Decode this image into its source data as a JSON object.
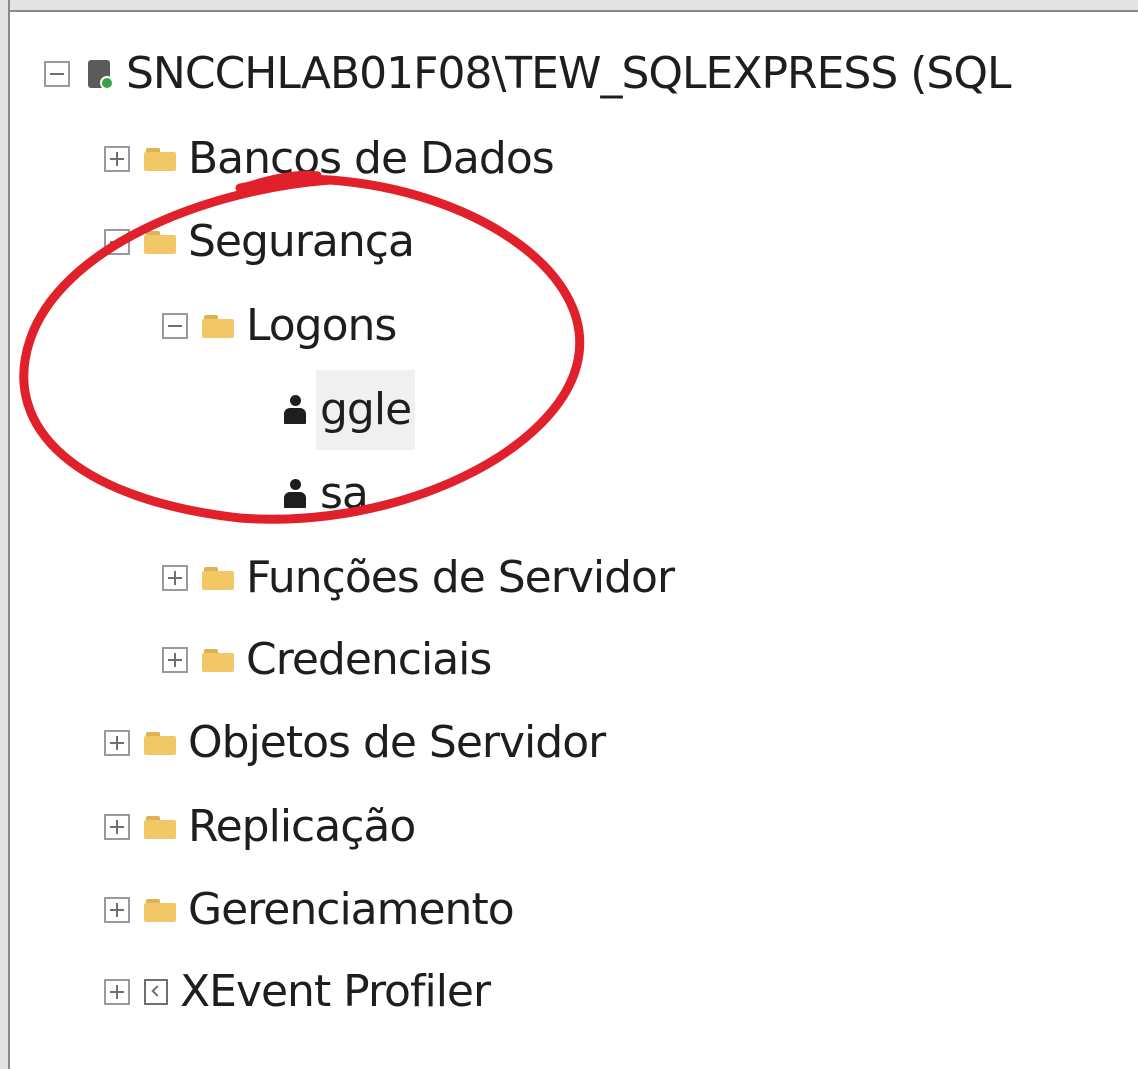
{
  "tree": {
    "server": {
      "label": "SNCCHLAB01F08\\TEW_SQLEXPRESS (SQL",
      "icon": "server-icon",
      "status_color": "#3aa043",
      "expanded": true
    },
    "databases": {
      "label": "Bancos de Dados",
      "expanded": false
    },
    "security": {
      "label": "Segurança",
      "expanded": true,
      "logins": {
        "label": "Logons",
        "expanded": true,
        "items": [
          {
            "label": "ggle",
            "icon": "user-icon",
            "selected": true
          },
          {
            "label": "sa",
            "icon": "user-icon",
            "selected": false
          }
        ]
      },
      "server_roles": {
        "label": "Funções de Servidor",
        "expanded": false
      },
      "credentials": {
        "label": "Credenciais",
        "expanded": false
      }
    },
    "server_objects": {
      "label": "Objetos de Servidor",
      "expanded": false
    },
    "replication": {
      "label": "Replicação",
      "expanded": false
    },
    "management": {
      "label": "Gerenciamento",
      "expanded": false
    },
    "xevent_profiler": {
      "label": "XEvent Profiler",
      "icon": "profiler-icon",
      "expanded": false
    }
  },
  "colors": {
    "folder": "#f1c865",
    "selection": "#f0f0f0",
    "annotation": "#e0202a"
  }
}
